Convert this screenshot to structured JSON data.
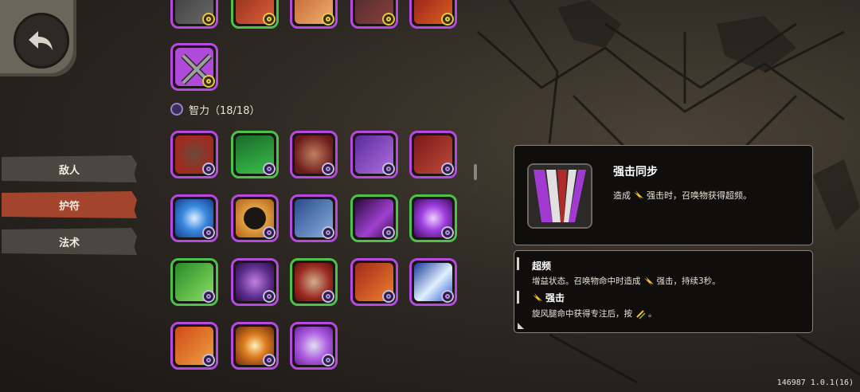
{
  "tabs": [
    {
      "label": "敌人",
      "active": false
    },
    {
      "label": "护符",
      "active": true
    },
    {
      "label": "法术",
      "active": false
    }
  ],
  "section": {
    "label": "智力（18/18）"
  },
  "grid_rows": [
    [
      "purple",
      "green",
      "purple",
      "purple",
      "purple"
    ],
    [
      "purple"
    ],
    [
      "purple",
      "green",
      "purple",
      "purple",
      "purple"
    ],
    [
      "purple",
      "purple",
      "purple",
      "green",
      "purple"
    ],
    [
      "green",
      "purple",
      "green",
      "purple",
      "purple"
    ],
    [
      "purple",
      "purple",
      "purple"
    ]
  ],
  "detail": {
    "title": "强击同步",
    "desc_prefix": "造成",
    "desc_suffix": "强击时，召唤物获得超频。"
  },
  "keywords": [
    {
      "title": "超频",
      "desc_prefix": "增益状态。召唤物命中时造成",
      "desc_suffix": "强击，持续3秒。"
    },
    {
      "title": "强击",
      "desc_prefix": "旋风腿命中获得专注后，按",
      "desc_suffix": "。"
    }
  ],
  "version": "146987 1.0.1(16)",
  "colors": {
    "accent_tab": "#a2452c",
    "intellect_purple": "#b64ae0",
    "green_border": "#4cc24a"
  }
}
